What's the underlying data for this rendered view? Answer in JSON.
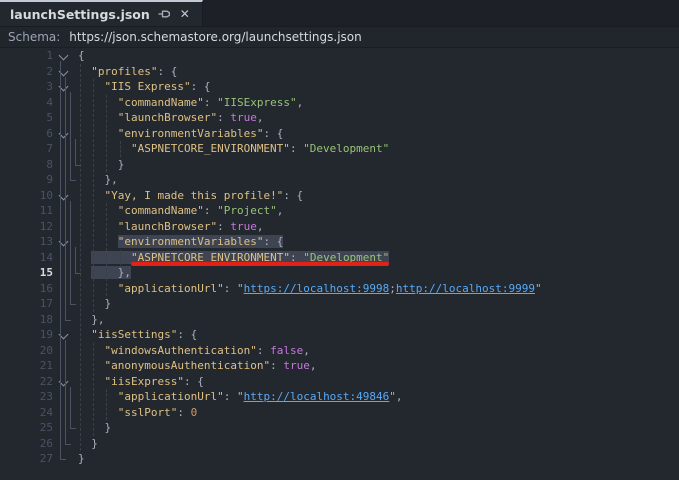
{
  "tab": {
    "title": "launchSettings.json",
    "icons": [
      "pin-icon",
      "close-icon"
    ],
    "close_glyph": "✕"
  },
  "schema_bar": {
    "label": "Schema:",
    "url": "https://json.schemastore.org/launchsettings.json"
  },
  "colors": {
    "editor_bg": "#23272e",
    "tabbar_bg": "#1d2127",
    "key": "#dec184",
    "string": "#98c379",
    "boolean": "#c678dd",
    "number": "#d19a66",
    "link": "#57aaf7",
    "punctuation": "#abb2bf",
    "line_number": "#4b5263",
    "active_line_number": "#d7dae0",
    "selection": "#3e4452",
    "red_annotation": "#e32119"
  },
  "code": {
    "active_line": 15,
    "lines": [
      {
        "n": 1,
        "fold": true,
        "segs": [
          [
            "punc",
            "{"
          ]
        ]
      },
      {
        "n": 2,
        "fold": true,
        "segs": [
          [
            "ws",
            "  "
          ],
          [
            "key",
            "\"profiles\""
          ],
          [
            "punc",
            ": {"
          ]
        ]
      },
      {
        "n": 3,
        "fold": true,
        "segs": [
          [
            "ws",
            "    "
          ],
          [
            "key",
            "\"IIS Express\""
          ],
          [
            "punc",
            ": {"
          ]
        ]
      },
      {
        "n": 4,
        "segs": [
          [
            "ws",
            "      "
          ],
          [
            "key",
            "\"commandName\""
          ],
          [
            "punc",
            ": "
          ],
          [
            "str",
            "\"IISExpress\""
          ],
          [
            "punc",
            ","
          ]
        ]
      },
      {
        "n": 5,
        "segs": [
          [
            "ws",
            "      "
          ],
          [
            "key",
            "\"launchBrowser\""
          ],
          [
            "punc",
            ": "
          ],
          [
            "bool",
            "true"
          ],
          [
            "punc",
            ","
          ]
        ]
      },
      {
        "n": 6,
        "fold": true,
        "segs": [
          [
            "ws",
            "      "
          ],
          [
            "key",
            "\"environmentVariables\""
          ],
          [
            "punc",
            ": {"
          ]
        ]
      },
      {
        "n": 7,
        "segs": [
          [
            "ws",
            "        "
          ],
          [
            "key",
            "\"ASPNETCORE_ENVIRONMENT\""
          ],
          [
            "punc",
            ": "
          ],
          [
            "str",
            "\"Development\""
          ]
        ]
      },
      {
        "n": 8,
        "segs": [
          [
            "ws",
            "      "
          ],
          [
            "punc",
            "}"
          ]
        ]
      },
      {
        "n": 9,
        "segs": [
          [
            "ws",
            "    "
          ],
          [
            "punc",
            "},"
          ]
        ]
      },
      {
        "n": 10,
        "fold": true,
        "segs": [
          [
            "ws",
            "    "
          ],
          [
            "key",
            "\"Yay, I made this profile!\""
          ],
          [
            "punc",
            ": {"
          ]
        ]
      },
      {
        "n": 11,
        "segs": [
          [
            "ws",
            "      "
          ],
          [
            "key",
            "\"commandName\""
          ],
          [
            "punc",
            ": "
          ],
          [
            "str",
            "\"Project\""
          ],
          [
            "punc",
            ","
          ]
        ]
      },
      {
        "n": 12,
        "segs": [
          [
            "ws",
            "      "
          ],
          [
            "key",
            "\"launchBrowser\""
          ],
          [
            "punc",
            ": "
          ],
          [
            "bool",
            "true"
          ],
          [
            "punc",
            ","
          ]
        ]
      },
      {
        "n": 13,
        "fold": true,
        "segs": [
          [
            "ws",
            "      "
          ],
          [
            "key",
            "\"environmentVariables\"",
            1
          ],
          [
            "punc",
            ": ",
            1
          ],
          [
            "punc",
            "{",
            1
          ]
        ]
      },
      {
        "n": 14,
        "red": [
          8,
          39
        ],
        "segs": [
          [
            "ws",
            "  "
          ],
          [
            "ws",
            "      ",
            1
          ],
          [
            "key",
            "\"ASPNETCORE_ENVIRONMENT\"",
            1
          ],
          [
            "punc",
            ": ",
            1
          ],
          [
            "str",
            "\"Development\"",
            1
          ]
        ]
      },
      {
        "n": 15,
        "segs": [
          [
            "ws",
            "  "
          ],
          [
            "ws",
            "    ",
            1
          ],
          [
            "punc",
            "},",
            1
          ]
        ]
      },
      {
        "n": 16,
        "segs": [
          [
            "ws",
            "      "
          ],
          [
            "key",
            "\"applicationUrl\""
          ],
          [
            "punc",
            ": "
          ],
          [
            "punc",
            "\""
          ],
          [
            "link",
            "https://localhost:9998"
          ],
          [
            "punc",
            ";"
          ],
          [
            "link",
            "http://localhost:9999"
          ],
          [
            "punc",
            "\""
          ]
        ]
      },
      {
        "n": 17,
        "segs": [
          [
            "ws",
            "    "
          ],
          [
            "punc",
            "}"
          ]
        ]
      },
      {
        "n": 18,
        "segs": [
          [
            "ws",
            "  "
          ],
          [
            "punc",
            "},"
          ]
        ]
      },
      {
        "n": 19,
        "fold": true,
        "segs": [
          [
            "ws",
            "  "
          ],
          [
            "key",
            "\"iisSettings\""
          ],
          [
            "punc",
            ": {"
          ]
        ]
      },
      {
        "n": 20,
        "segs": [
          [
            "ws",
            "    "
          ],
          [
            "key",
            "\"windowsAuthentication\""
          ],
          [
            "punc",
            ": "
          ],
          [
            "bool",
            "false"
          ],
          [
            "punc",
            ","
          ]
        ]
      },
      {
        "n": 21,
        "segs": [
          [
            "ws",
            "    "
          ],
          [
            "key",
            "\"anonymousAuthentication\""
          ],
          [
            "punc",
            ": "
          ],
          [
            "bool",
            "true"
          ],
          [
            "punc",
            ","
          ]
        ]
      },
      {
        "n": 22,
        "fold": true,
        "segs": [
          [
            "ws",
            "    "
          ],
          [
            "key",
            "\"iisExpress\""
          ],
          [
            "punc",
            ": {"
          ]
        ]
      },
      {
        "n": 23,
        "segs": [
          [
            "ws",
            "      "
          ],
          [
            "key",
            "\"applicationUrl\""
          ],
          [
            "punc",
            ": "
          ],
          [
            "punc",
            "\""
          ],
          [
            "link",
            "http://localhost:49846"
          ],
          [
            "punc",
            "\","
          ]
        ]
      },
      {
        "n": 24,
        "segs": [
          [
            "ws",
            "      "
          ],
          [
            "key",
            "\"sslPort\""
          ],
          [
            "punc",
            ": "
          ],
          [
            "num",
            "0"
          ]
        ]
      },
      {
        "n": 25,
        "segs": [
          [
            "ws",
            "    "
          ],
          [
            "punc",
            "}"
          ]
        ]
      },
      {
        "n": 26,
        "segs": [
          [
            "ws",
            "  "
          ],
          [
            "punc",
            "}"
          ]
        ]
      },
      {
        "n": 27,
        "segs": [
          [
            "ws",
            ""
          ],
          [
            "punc",
            "}"
          ]
        ]
      }
    ],
    "folds": [
      {
        "from": 1,
        "to": 27,
        "d": 0
      },
      {
        "from": 2,
        "to": 18,
        "d": 1
      },
      {
        "from": 3,
        "to": 9,
        "d": 2
      },
      {
        "from": 6,
        "to": 8,
        "d": 3
      },
      {
        "from": 10,
        "to": 17,
        "d": 2
      },
      {
        "from": 13,
        "to": 15,
        "d": 3
      },
      {
        "from": 19,
        "to": 26,
        "d": 1
      },
      {
        "from": 22,
        "to": 25,
        "d": 2
      }
    ],
    "guides": [
      {
        "col": 0,
        "from": 2,
        "to": 26
      },
      {
        "col": 2,
        "from": 3,
        "to": 17
      },
      {
        "col": 2,
        "from": 20,
        "to": 25
      },
      {
        "col": 4,
        "from": 4,
        "to": 8
      },
      {
        "col": 4,
        "from": 11,
        "to": 16
      },
      {
        "col": 4,
        "from": 23,
        "to": 24
      },
      {
        "col": 6,
        "from": 7,
        "to": 7
      },
      {
        "col": 6,
        "from": 14,
        "to": 14
      }
    ]
  }
}
